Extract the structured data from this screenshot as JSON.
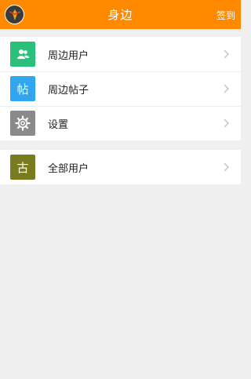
{
  "header": {
    "title": "身边",
    "action_label": "签到"
  },
  "group1": {
    "items": [
      {
        "label": "周边用户",
        "icon": "users-icon",
        "color": "#2bc07a"
      },
      {
        "label": "周边帖子",
        "icon": "posts-icon",
        "icon_text": "帖",
        "color": "#2fa6ee"
      },
      {
        "label": "设置",
        "icon": "gear-icon",
        "color": "#8a8a8a"
      }
    ]
  },
  "group2": {
    "items": [
      {
        "label": "全部用户",
        "icon": "all-users-icon",
        "icon_text": "古",
        "color": "#7a7a1e"
      }
    ]
  }
}
